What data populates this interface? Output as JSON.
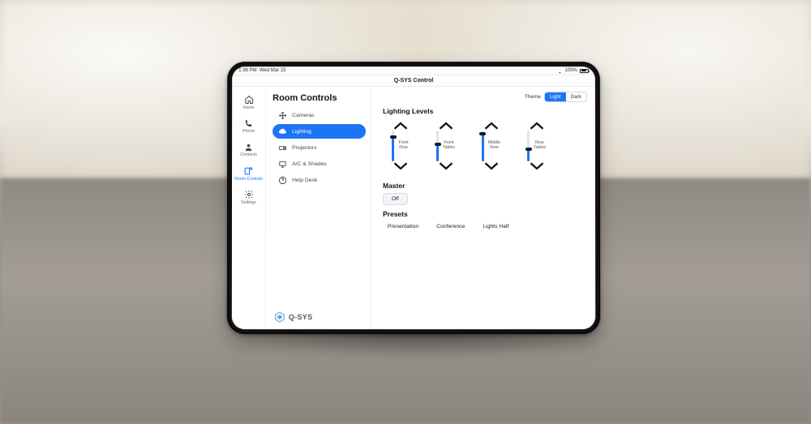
{
  "status": {
    "time": "1:38 PM",
    "date": "Wed Mar 15",
    "battery": "100%"
  },
  "app": {
    "title": "Q-SYS Control"
  },
  "rail": [
    {
      "label": "Home"
    },
    {
      "label": "Phone"
    },
    {
      "label": "Contacts"
    },
    {
      "label": "Room Controls",
      "active": true
    },
    {
      "label": "Settings"
    }
  ],
  "panel": {
    "title": "Room Controls",
    "items": [
      {
        "label": "Cameras"
      },
      {
        "label": "Lighting",
        "active": true
      },
      {
        "label": "Projectors"
      },
      {
        "label": "A/C & Shades"
      },
      {
        "label": "Help Desk"
      }
    ]
  },
  "brand": {
    "name": "Q-SYS"
  },
  "theme": {
    "label": "Theme",
    "options": [
      "Light",
      "Dark"
    ],
    "active": "Light"
  },
  "sections": {
    "lighting": {
      "title": "Lighting Levels",
      "sliders": [
        {
          "label": "Front\nRow",
          "level": 80
        },
        {
          "label": "Front\nTables",
          "level": 55
        },
        {
          "label": "Middle\nRow",
          "level": 90
        },
        {
          "label": "Rear\nTables",
          "level": 40
        }
      ]
    },
    "master": {
      "title": "Master",
      "button": "Off"
    },
    "presets": {
      "title": "Presets",
      "items": [
        "Presentation",
        "Conference",
        "Lights Half"
      ]
    }
  },
  "colors": {
    "accent": "#1d74f5"
  }
}
